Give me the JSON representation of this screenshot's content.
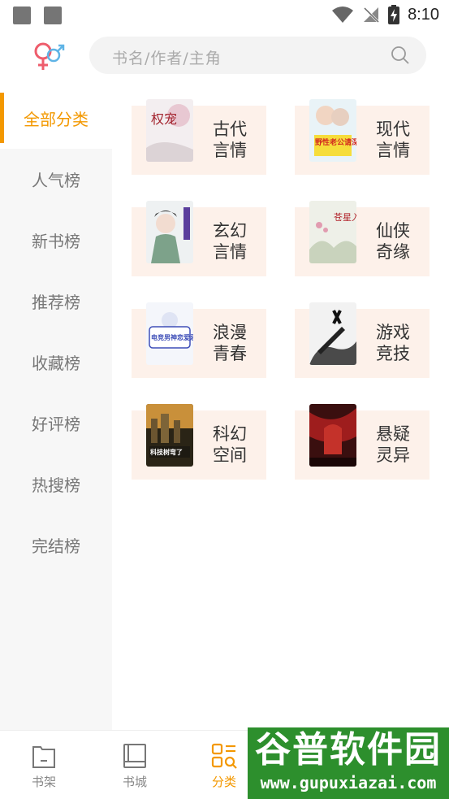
{
  "status_bar": {
    "time": "8:10"
  },
  "header": {
    "search_placeholder": "书名/作者/主角"
  },
  "sidebar": {
    "items": [
      {
        "label": "全部分类",
        "active": true
      },
      {
        "label": "人气榜"
      },
      {
        "label": "新书榜"
      },
      {
        "label": "推荐榜"
      },
      {
        "label": "收藏榜"
      },
      {
        "label": "好评榜"
      },
      {
        "label": "热搜榜"
      },
      {
        "label": "完结榜"
      }
    ]
  },
  "categories": [
    {
      "line1": "古代",
      "line2": "言情",
      "cover_text": "权宠"
    },
    {
      "line1": "现代",
      "line2": "言情",
      "cover_text": "野性老公请深爱!"
    },
    {
      "line1": "玄幻",
      "line2": "言情",
      "cover_text": ""
    },
    {
      "line1": "仙侠",
      "line2": "奇缘",
      "cover_text": "苍星入尧"
    },
    {
      "line1": "浪漫",
      "line2": "青春",
      "cover_text": "电竞男神恋爱忌"
    },
    {
      "line1": "游戏",
      "line2": "竞技",
      "cover_text": ""
    },
    {
      "line1": "科幻",
      "line2": "空间",
      "cover_text": "科技树弯了"
    },
    {
      "line1": "悬疑",
      "line2": "灵异",
      "cover_text": ""
    }
  ],
  "bottom_nav": {
    "items": [
      {
        "label": "书架"
      },
      {
        "label": "书城"
      },
      {
        "label": "分类",
        "active": true
      }
    ]
  },
  "watermark": {
    "main": "谷普软件园",
    "url": "www.gupuxiazai.com"
  },
  "colors": {
    "accent": "#f39800",
    "card_bg": "#fdf1ea",
    "sidebar_bg": "#f7f7f7",
    "watermark_bg": "#2d8f2d"
  }
}
